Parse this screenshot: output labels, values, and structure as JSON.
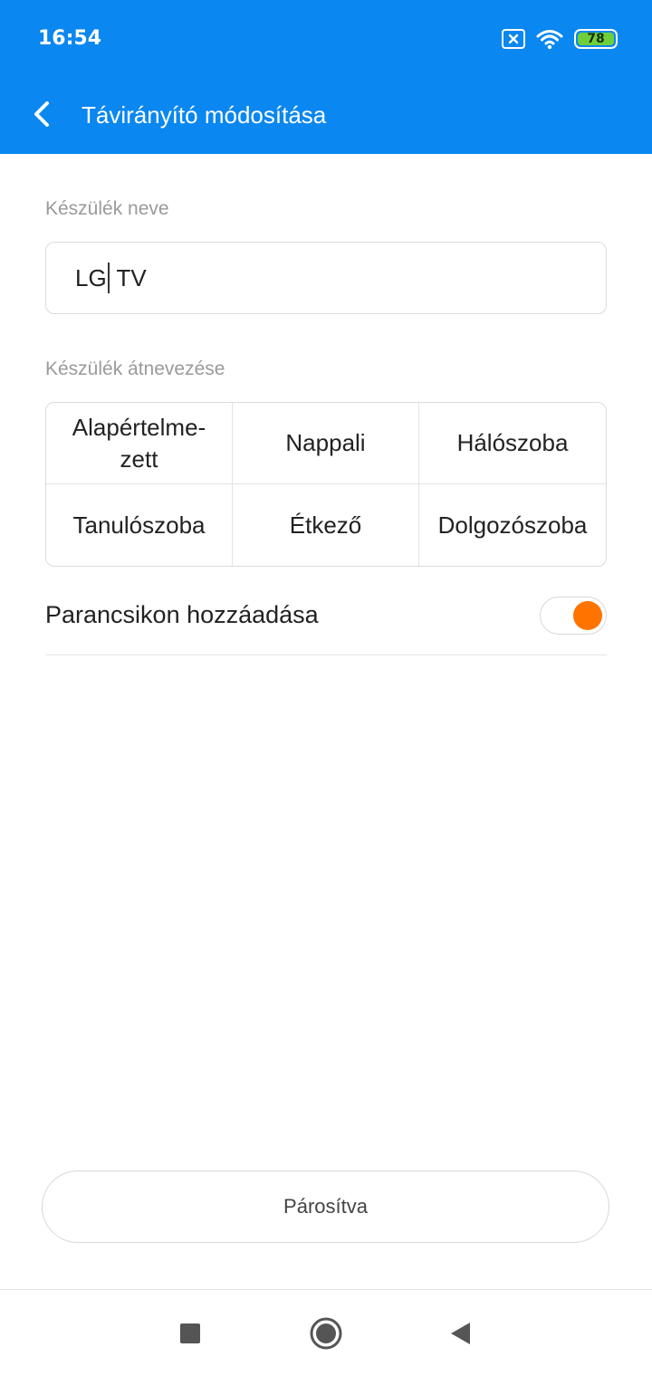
{
  "status_bar": {
    "time": "16:54",
    "battery_level": "78",
    "sim_icon": "sim-x-icon",
    "wifi_icon": "wifi-icon"
  },
  "header": {
    "title": "Távirányító módosítása",
    "back_icon": "chevron-left-icon"
  },
  "device_name": {
    "label": "Készülék neve",
    "value_before_caret": "LG",
    "value_after_caret": " TV"
  },
  "rename": {
    "label": "Készülék átnevezése",
    "options": [
      "Alapértelme-zett",
      "Nappali",
      "Hálószoba",
      "Tanulószoba",
      "Étkező",
      "Dolgozószoba"
    ]
  },
  "shortcut": {
    "label": "Parancsikon hozzáadása",
    "enabled": true
  },
  "paired_button": {
    "label": "Párosítva"
  },
  "colors": {
    "header_bg": "#0a87f0",
    "toggle_on": "#ff7300",
    "battery": "#6fcf3a"
  },
  "nav": {
    "recents_icon": "square-icon",
    "home_icon": "circle-home-icon",
    "back_icon": "triangle-back-icon"
  }
}
